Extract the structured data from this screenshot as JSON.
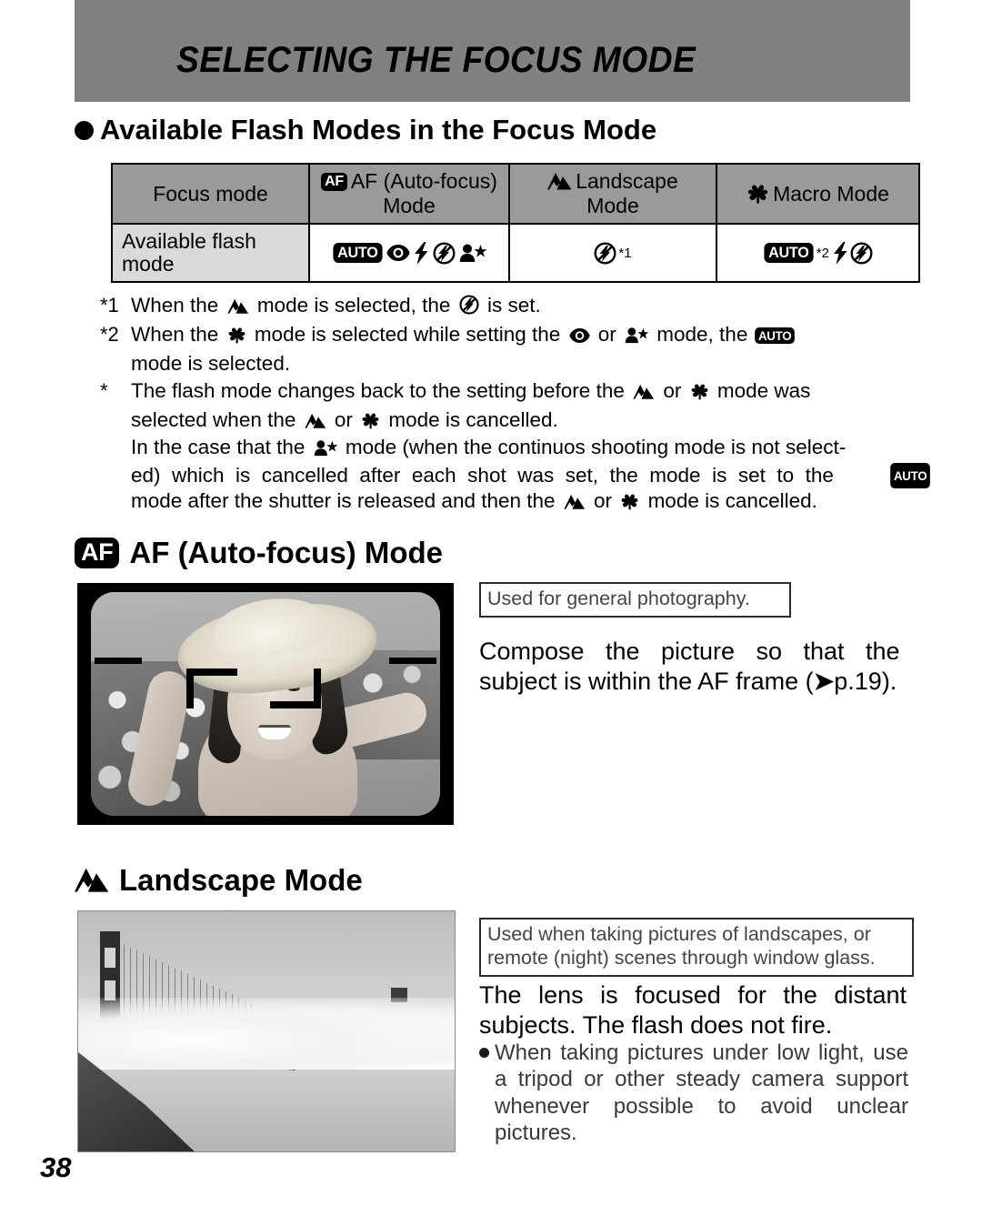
{
  "banner": {
    "title": "SELECTING THE FOCUS MODE",
    "bg_color": "#818181"
  },
  "section_heading": "Available Flash Modes in the Focus Mode",
  "table": {
    "header": [
      {
        "label": "Focus mode",
        "icon": ""
      },
      {
        "label": "AF (Auto-focus) Mode",
        "icon": "af-badge-icon"
      },
      {
        "label": "Landscape Mode",
        "icon": "landscape-icon"
      },
      {
        "label": "Macro Mode",
        "icon": "macro-flower-icon"
      }
    ],
    "row_label": "Available flash mode",
    "cells": [
      {
        "icons": [
          "auto-badge-icon",
          "red-eye-icon",
          "flash-bolt-icon",
          "flash-off-icon",
          "night-portrait-icon"
        ],
        "note": ""
      },
      {
        "icons": [
          "flash-off-icon"
        ],
        "note": "*1"
      },
      {
        "icons": [
          "auto-badge-icon",
          "flash-bolt-icon",
          "flash-off-icon"
        ],
        "note": "*2"
      }
    ],
    "header_bg": "#9a9a9a",
    "row_label_bg": "#d9d9d9"
  },
  "footnotes": [
    {
      "mark": "*1",
      "parts": [
        {
          "t": "text",
          "v": "When the "
        },
        {
          "t": "icon",
          "v": "landscape-icon"
        },
        {
          "t": "text",
          "v": " mode is selected, the "
        },
        {
          "t": "icon",
          "v": "flash-off-icon"
        },
        {
          "t": "text",
          "v": " is set."
        }
      ]
    },
    {
      "mark": "*2",
      "parts": [
        {
          "t": "text",
          "v": "When the "
        },
        {
          "t": "icon",
          "v": "macro-flower-icon"
        },
        {
          "t": "text",
          "v": " mode is selected while setting the "
        },
        {
          "t": "icon",
          "v": "red-eye-icon"
        },
        {
          "t": "text",
          "v": " or "
        },
        {
          "t": "icon",
          "v": "night-portrait-icon"
        },
        {
          "t": "text",
          "v": " mode, the "
        },
        {
          "t": "icon",
          "v": "auto-badge-icon"
        },
        {
          "t": "text",
          "v": " mode is selected."
        }
      ]
    },
    {
      "mark": "*",
      "parts": [
        {
          "t": "text",
          "v": "The flash mode changes back to the setting before the "
        },
        {
          "t": "icon",
          "v": "landscape-icon"
        },
        {
          "t": "text",
          "v": " or "
        },
        {
          "t": "icon",
          "v": "macro-flower-icon"
        },
        {
          "t": "text",
          "v": " mode was selected when  the "
        },
        {
          "t": "icon",
          "v": "landscape-icon"
        },
        {
          "t": "text",
          "v": " or "
        },
        {
          "t": "icon",
          "v": "macro-flower-icon"
        },
        {
          "t": "text",
          "v": " mode is cancelled."
        }
      ]
    },
    {
      "mark": "",
      "parts": [
        {
          "t": "text",
          "v": "In the case that the "
        },
        {
          "t": "icon",
          "v": "night-portrait-icon"
        },
        {
          "t": "text",
          "v": " mode (when the continuos shooting mode is not selected) which is cancelled after each shot was set, the mode is set to the "
        },
        {
          "t": "icon",
          "v": "auto-badge-icon"
        },
        {
          "t": "text",
          "v": " mode after the shutter is released and then the "
        },
        {
          "t": "icon",
          "v": "landscape-icon"
        },
        {
          "t": "text",
          "v": " or "
        },
        {
          "t": "icon",
          "v": "macro-flower-icon"
        },
        {
          "t": "text",
          "v": " mode is cancelled."
        }
      ]
    }
  ],
  "af_section": {
    "heading": "AF (Auto-focus) Mode",
    "heading_icon": "af-badge-icon",
    "box_note": "Used for general photography.",
    "body": "Compose the picture so that the subject is within the AF frame (➔p.19).",
    "photo_alt": "viewfinder-photo-woman-with-straw-hat"
  },
  "landscape_section": {
    "heading": "Landscape Mode",
    "heading_icon": "landscape-icon",
    "box_note": "Used when taking pictures of landscapes, or remote (night) scenes through window glass.",
    "body": "The lens is focused for the distant subjects. The flash does not fire.",
    "bullet": "When taking pictures under low light, use a tripod or other steady camera support whenever possible to avoid unclear pictures.",
    "photo_alt": "landscape-photo-bridge-in-fog"
  },
  "page_number": "38",
  "icon_labels": {
    "af": "AF",
    "auto": "AUTO"
  }
}
